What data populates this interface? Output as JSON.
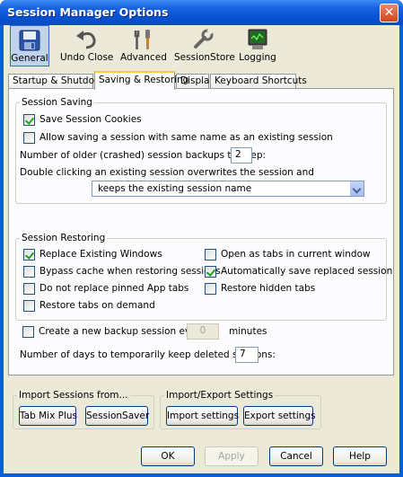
{
  "window": {
    "title": "Session Manager Options",
    "close_label": "✕"
  },
  "toolbar": {
    "items": [
      {
        "label": "General",
        "icon": "floppy-disk-icon"
      },
      {
        "label": "Undo Close",
        "icon": "undo-icon"
      },
      {
        "label": "Advanced",
        "icon": "tools-icon"
      },
      {
        "label": "SessionStore",
        "icon": "wrench-icon"
      },
      {
        "label": "Logging",
        "icon": "monitor-icon"
      }
    ],
    "selected": "General"
  },
  "tabs": [
    "Startup & Shutdown",
    "Saving & Restoring",
    "Display",
    "Keyboard Shortcuts"
  ],
  "active_tab": "Saving & Restoring",
  "session_saving": {
    "title": "Session Saving",
    "save_cookies": {
      "label": "Save Session Cookies",
      "checked": true
    },
    "allow_same_name": {
      "label": "Allow saving a session with same name as an existing session",
      "checked": false
    },
    "backups_label": "Number of older (crashed) session backups to keep:",
    "backups_value": "2",
    "double_click_label": "Double clicking an existing session overwrites the session and",
    "double_click_value": "keeps the existing session name"
  },
  "session_restoring": {
    "title": "Session Restoring",
    "replace_windows": {
      "label": "Replace Existing Windows",
      "checked": true
    },
    "bypass_cache": {
      "label": "Bypass cache when restoring sessions",
      "checked": false
    },
    "no_replace_pinned": {
      "label": "Do not replace pinned App tabs",
      "checked": false
    },
    "restore_on_demand": {
      "label": "Restore tabs on demand",
      "checked": false
    },
    "open_as_tabs": {
      "label": "Open as tabs in current window",
      "checked": false
    },
    "auto_save_replaced": {
      "label": "Automatically save replaced session",
      "checked": true
    },
    "restore_hidden": {
      "label": "Restore hidden tabs",
      "checked": false
    }
  },
  "backup_session": {
    "label": "Create a new backup session every",
    "checked": false,
    "value": "0",
    "unit": "minutes"
  },
  "deleted_days": {
    "label": "Number of days to temporarily keep deleted sessions:",
    "value": "7"
  },
  "import_sessions": {
    "title": "Import Sessions from...",
    "tabmix": "Tab Mix Plus",
    "sessionsaver": "SessionSaver"
  },
  "import_export": {
    "title": "Import/Export Settings",
    "import": "Import settings",
    "export": "Export settings"
  },
  "buttons": {
    "ok": "OK",
    "apply": "Apply",
    "cancel": "Cancel",
    "help": "Help"
  }
}
